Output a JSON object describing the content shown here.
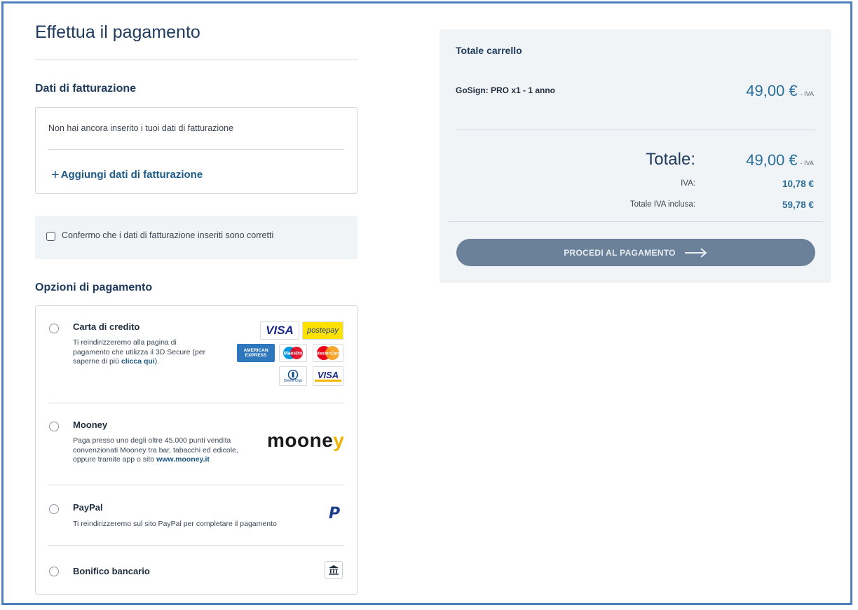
{
  "page": {
    "title": "Effettua il pagamento"
  },
  "billing": {
    "heading": "Dati di fatturazione",
    "empty_text": "Non hai ancora inserito i tuoi dati di fatturazione",
    "add_link": "Aggiungi dati di fatturazione"
  },
  "confirm": {
    "label": "Confermo che i dati di fatturazione inseriti sono corretti",
    "checked": false
  },
  "payment": {
    "heading": "Opzioni di pagamento",
    "credit_card": {
      "title": "Carta di credito",
      "desc_1": "Ti reindirizzeremo alla pagina di",
      "desc_2": "pagamento che utilizza il 3D Secure (per",
      "desc_3": "saperne di più ",
      "link": "clicca qui",
      "desc_4": ").",
      "logos": {
        "visa": "VISA",
        "postepay": "postepay",
        "amex_1": "AMERICAN",
        "amex_2": "EXPRESS",
        "maestro": "Maestro",
        "mastercard": "MasterCard",
        "diners_1": "Diners Club",
        "diners_2": "INTERNATIONAL",
        "visa_electron": "VISA",
        "visa_electron_sub": "Electron"
      }
    },
    "mooney": {
      "title": "Mooney",
      "desc_1": "Paga presso uno degli oltre 45.000 punti vendita",
      "desc_2": "convenzionati Mooney tra bar, tabacchi ed edicole,",
      "desc_3": "oppure tramite app o sito ",
      "link": "www.mooney.it",
      "logo_main": "moone",
      "logo_accent": "y"
    },
    "paypal": {
      "title": "PayPal",
      "desc": "Ti reindirizzeremo sul sito PayPal per completare il pagamento",
      "icon_letter": "P"
    },
    "bank": {
      "title": "Bonifico bancario"
    }
  },
  "cart": {
    "title": "Totale carrello",
    "item_name": "GoSign: PRO x1 - 1 anno",
    "item_price": "49,00 €",
    "iva_suffix": "- IVA",
    "total_label": "Totale:",
    "total_price": "49,00 €",
    "iva_label": "IVA:",
    "iva_value": "10,78 €",
    "total_incl_label": "Totale IVA inclusa:",
    "total_incl_value": "59,78 €",
    "proceed_button": "PROCEDI AL PAGAMENTO"
  },
  "colors": {
    "accent": "#2a6e9a",
    "border": "#4f7fbf",
    "button": "#6b8199",
    "panel": "#f1f4f7"
  }
}
